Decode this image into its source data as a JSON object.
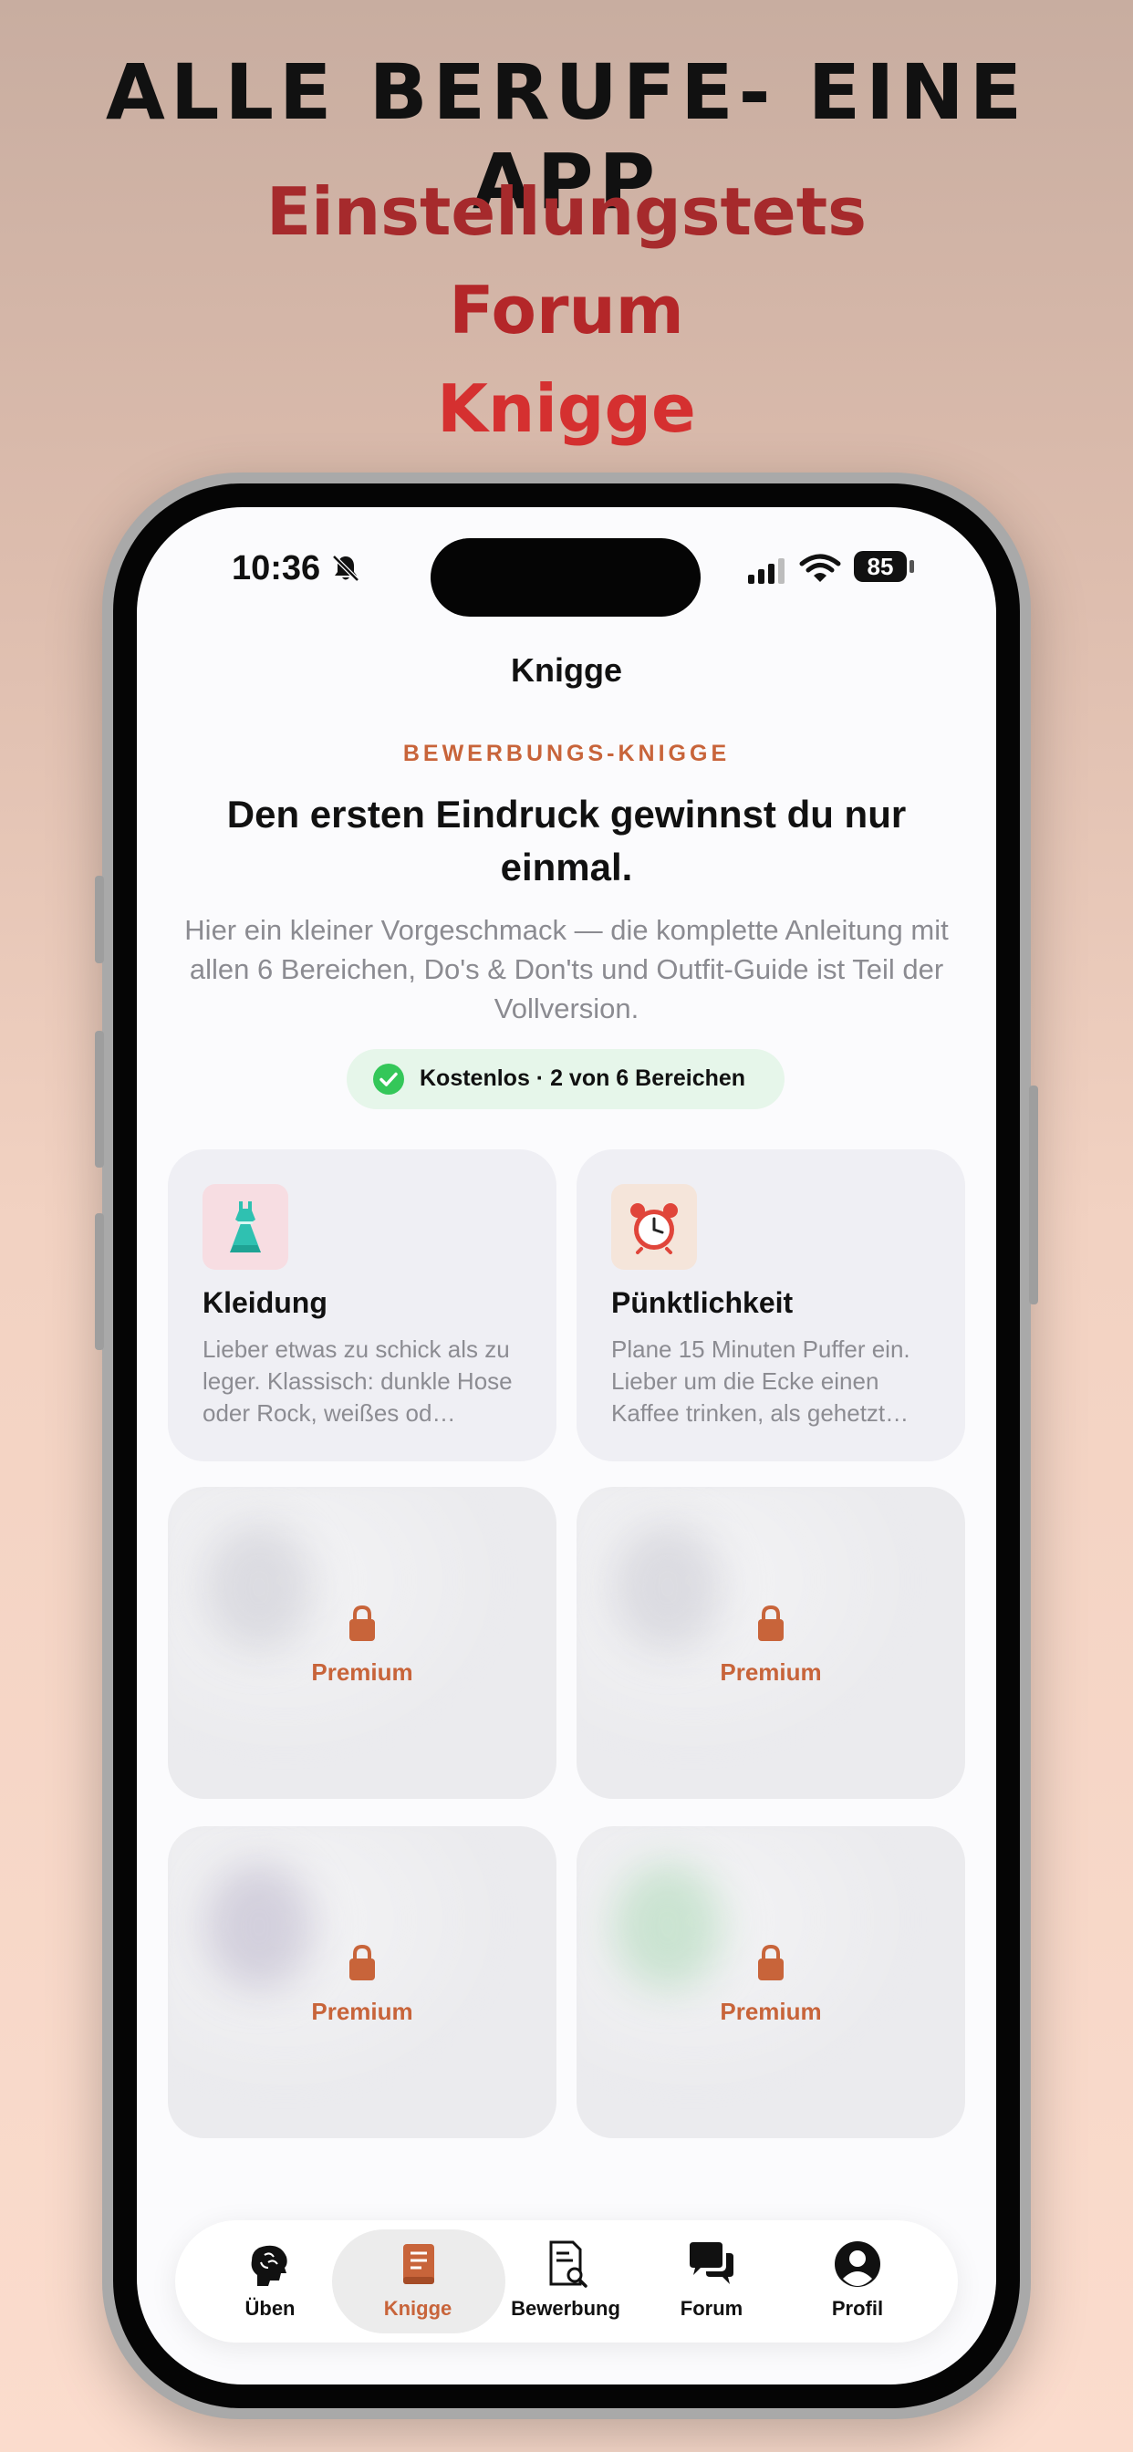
{
  "promo": {
    "title": "ALLE BERUFE- EINE APP",
    "lines": [
      "Einstellungstets",
      "Forum",
      "Knigge"
    ]
  },
  "status_bar": {
    "time": "10:36",
    "battery": "85",
    "icons": [
      "bell-slash-icon",
      "signal-icon",
      "wifi-icon",
      "battery-icon"
    ]
  },
  "nav": {
    "title": "Knigge"
  },
  "intro": {
    "eyebrow": "BEWERBUNGS-KNIGGE",
    "headline": "Den ersten Eindruck gewinnst du nur einmal.",
    "description": "Hier ein kleiner Vorgeschmack — die komplette Anleitung mit allen 6 Bereichen, Do's & Don'ts und Outfit-Guide ist Teil der Vollversion."
  },
  "badge": {
    "text": "Kostenlos · 2 von 6 Bereichen",
    "icon": "checkmark-circle-icon",
    "color": "#34c759"
  },
  "cards": [
    {
      "title": "Kleidung",
      "description": "Lieber etwas zu schick als zu leger. Klassisch: dunkle Hose oder Rock, weißes od…",
      "icon": "dress-icon",
      "icon_bg": "#f7dde2"
    },
    {
      "title": "Pünktlichkeit",
      "description": "Plane 15 Minuten Puffer ein. Lieber um die Ecke einen Kaffee trinken, als gehetzt…",
      "icon": "alarm-clock-icon",
      "icon_bg": "#f5e5da"
    }
  ],
  "locked_cards": [
    {
      "label": "Premium",
      "icon": "lock-icon"
    },
    {
      "label": "Premium",
      "icon": "lock-icon"
    },
    {
      "label": "Premium",
      "icon": "lock-icon"
    },
    {
      "label": "Premium",
      "icon": "lock-icon"
    }
  ],
  "tabs": [
    {
      "label": "Üben",
      "icon": "brain-icon",
      "active": false
    },
    {
      "label": "Knigge",
      "icon": "book-icon",
      "active": true
    },
    {
      "label": "Bewerbung",
      "icon": "document-search-icon",
      "active": false
    },
    {
      "label": "Forum",
      "icon": "chat-bubbles-icon",
      "active": false
    },
    {
      "label": "Profil",
      "icon": "person-circle-icon",
      "active": false
    }
  ],
  "colors": {
    "accent": "#c8643a",
    "promo_red": "#b42729",
    "success": "#34c759"
  }
}
